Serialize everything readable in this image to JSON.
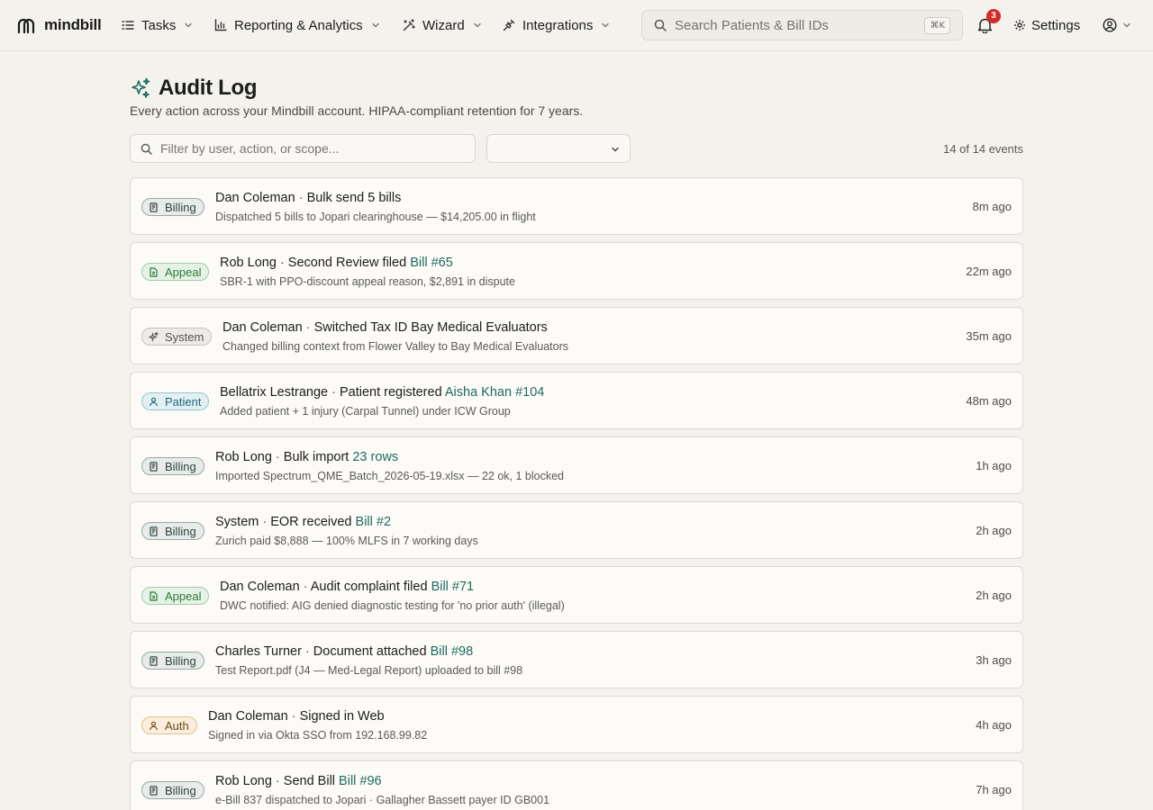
{
  "app": {
    "brand": "mindbill"
  },
  "nav": {
    "tasks": "Tasks",
    "reporting": "Reporting & Analytics",
    "wizard": "Wizard",
    "integrations": "Integrations"
  },
  "search": {
    "placeholder": "Search Patients & Bill IDs",
    "shortcut": "⌘K"
  },
  "notifications": {
    "count": "3"
  },
  "settings": {
    "label": "Settings"
  },
  "page": {
    "title": "Audit Log",
    "subtitle": "Every action across your Mindbill account. HIPAA-compliant retention for 7 years."
  },
  "filter": {
    "placeholder": "Filter by user, action, or scope...",
    "select_value": ""
  },
  "count": "14 of 14 events",
  "colors": {
    "accent_link": "#1e6a5e",
    "badge_red": "#d42a2a",
    "background": "#f4f2ed"
  },
  "events": [
    {
      "tag": "Billing",
      "tag_class": "billing",
      "icon": "receipt-icon",
      "user": "Dan Coleman",
      "action": "Bulk send 5 bills",
      "link": "",
      "detail": "Dispatched 5 bills to Jopari clearinghouse — $14,205.00 in flight",
      "time": "8m ago"
    },
    {
      "tag": "Appeal",
      "tag_class": "appeal",
      "icon": "document-icon",
      "user": "Rob Long",
      "action": "Second Review filed",
      "link": "Bill #65",
      "detail": "SBR-1 with PPO-discount appeal reason, $2,891 in dispute",
      "time": "22m ago"
    },
    {
      "tag": "System",
      "tag_class": "system",
      "icon": "sparkle-icon",
      "user": "Dan Coleman",
      "action": "Switched Tax ID Bay Medical Evaluators",
      "link": "",
      "detail": "Changed billing context from Flower Valley to Bay Medical Evaluators",
      "time": "35m ago"
    },
    {
      "tag": "Patient",
      "tag_class": "patient",
      "icon": "person-icon",
      "user": "Bellatrix Lestrange",
      "action": "Patient registered",
      "link": "Aisha Khan #104",
      "detail": "Added patient + 1 injury (Carpal Tunnel) under ICW Group",
      "time": "48m ago"
    },
    {
      "tag": "Billing",
      "tag_class": "billing",
      "icon": "receipt-icon",
      "user": "Rob Long",
      "action": "Bulk import",
      "link": "23 rows",
      "detail": "Imported Spectrum_QME_Batch_2026-05-19.xlsx — 22 ok, 1 blocked",
      "time": "1h ago"
    },
    {
      "tag": "Billing",
      "tag_class": "billing",
      "icon": "receipt-icon",
      "user": "System",
      "action": "EOR received",
      "link": "Bill #2",
      "detail": "Zurich paid $8,888 — 100% MLFS in 7 working days",
      "time": "2h ago"
    },
    {
      "tag": "Appeal",
      "tag_class": "appeal",
      "icon": "document-icon",
      "user": "Dan Coleman",
      "action": "Audit complaint filed",
      "link": "Bill #71",
      "detail": "DWC notified: AIG denied diagnostic testing for 'no prior auth' (illegal)",
      "time": "2h ago"
    },
    {
      "tag": "Billing",
      "tag_class": "billing",
      "icon": "receipt-icon",
      "user": "Charles Turner",
      "action": "Document attached",
      "link": "Bill #98",
      "detail": "Test Report.pdf (J4 — Med-Legal Report) uploaded to bill #98",
      "time": "3h ago"
    },
    {
      "tag": "Auth",
      "tag_class": "auth",
      "icon": "person-icon",
      "user": "Dan Coleman",
      "action": "Signed in Web",
      "link": "",
      "detail": "Signed in via Okta SSO from 192.168.99.82",
      "time": "4h ago"
    },
    {
      "tag": "Billing",
      "tag_class": "billing",
      "icon": "receipt-icon",
      "user": "Rob Long",
      "action": "Send Bill",
      "link": "Bill #96",
      "detail": "e-Bill 837 dispatched to Jopari · Gallagher Bassett payer ID GB001",
      "time": "7h ago"
    }
  ]
}
